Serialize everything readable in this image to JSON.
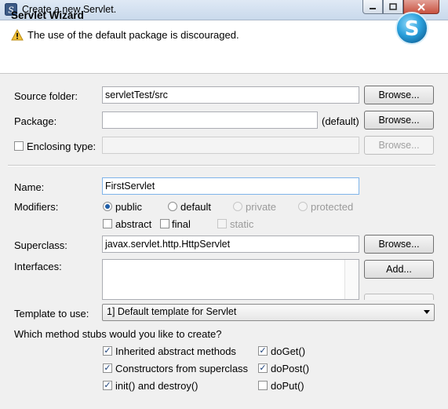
{
  "window": {
    "title": "Create a new Servlet."
  },
  "header": {
    "title": "Servlet Wizard",
    "warning": "The use of the default package is discouraged."
  },
  "source_folder": {
    "label": "Source folder:",
    "value": "servletTest/src",
    "browse": "Browse..."
  },
  "package": {
    "label": "Package:",
    "value": "",
    "suffix": "(default)",
    "browse": "Browse..."
  },
  "enclosing_type": {
    "label": "Enclosing type:",
    "checked": false,
    "value": "",
    "browse": "Browse..."
  },
  "name": {
    "label": "Name:",
    "value": "FirstServlet"
  },
  "modifiers": {
    "label": "Modifiers:",
    "access": [
      {
        "label": "public",
        "selected": true,
        "enabled": true
      },
      {
        "label": "default",
        "selected": false,
        "enabled": true
      },
      {
        "label": "private",
        "selected": false,
        "enabled": false
      },
      {
        "label": "protected",
        "selected": false,
        "enabled": false
      }
    ],
    "other": [
      {
        "label": "abstract",
        "checked": false,
        "enabled": true
      },
      {
        "label": "final",
        "checked": false,
        "enabled": true
      },
      {
        "label": "static",
        "checked": false,
        "enabled": false
      }
    ]
  },
  "superclass": {
    "label": "Superclass:",
    "value": "javax.servlet.http.HttpServlet",
    "browse": "Browse..."
  },
  "interfaces": {
    "label": "Interfaces:",
    "add": "Add..."
  },
  "template": {
    "label": "Template to use:",
    "value": "1] Default template for Servlet"
  },
  "method_stubs": {
    "question": "Which method stubs would you like to create?",
    "left": [
      {
        "label": "Inherited abstract methods",
        "checked": true
      },
      {
        "label": "Constructors from superclass",
        "checked": true
      },
      {
        "label": "init() and destroy()",
        "checked": true
      }
    ],
    "right": [
      {
        "label": "doGet()",
        "checked": true
      },
      {
        "label": "doPost()",
        "checked": true
      },
      {
        "label": "doPut()",
        "checked": false
      }
    ]
  },
  "colors": {
    "accent": "#1f5ea8",
    "warning": "#f2c037",
    "logo": "#2aa0dc"
  }
}
